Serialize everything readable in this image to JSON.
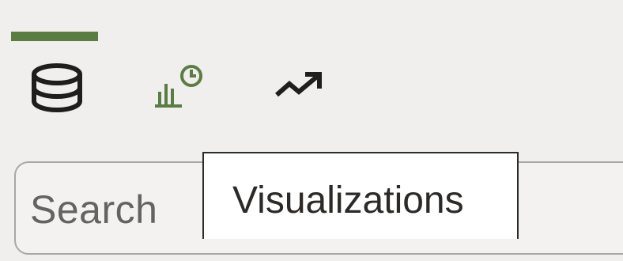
{
  "tabs": [
    {
      "icon": "database-icon",
      "state": "active"
    },
    {
      "icon": "visualizations-icon",
      "state": "hovered"
    },
    {
      "icon": "trend-arrow-icon",
      "state": "inactive"
    }
  ],
  "colors": {
    "accent": "#5b7c43",
    "icon_dark": "#1f1e1d",
    "background": "#f0efee"
  },
  "search": {
    "placeholder": "Search"
  },
  "tooltip": {
    "text": "Visualizations"
  }
}
